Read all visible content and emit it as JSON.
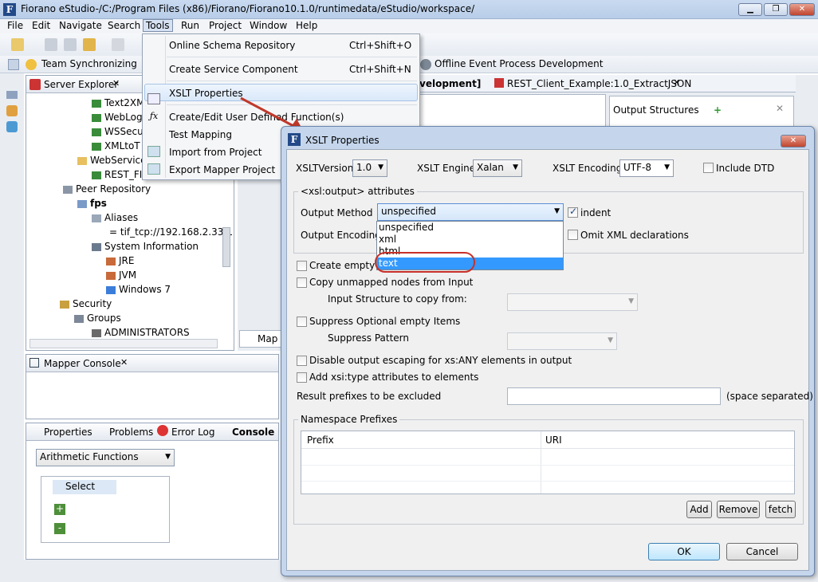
{
  "window": {
    "title": "Fiorano eStudio-/C:/Program Files (x86)/Fiorano/Fiorano10.1.0/runtimedata/eStudio/workspace/",
    "min": "▁",
    "max": "❐",
    "close": "✕"
  },
  "menubar": [
    "File",
    "Edit",
    "Navigate",
    "Search",
    "Tools",
    "Run",
    "Project",
    "Window",
    "Help"
  ],
  "perspectives": {
    "team": "Team Synchronizing",
    "offline": "Offline Event Process Development"
  },
  "server_explorer": {
    "tab": "Server Explorer",
    "items": [
      "Text2XM",
      "WebLog",
      "WSSecu",
      "XMLtoT",
      "WebService",
      "REST_FI",
      "Peer Repository",
      "fps",
      "Aliases",
      "= tif_tcp://192.168.2.33:1",
      "System Information",
      "JRE",
      "JVM",
      "Windows 7",
      "Security",
      "Groups",
      "ADMINISTRATORS"
    ]
  },
  "editor_tabs": {
    "tab1": "velopment]",
    "tab2": "REST_Client_Example:1.0_ExtractJSON",
    "output_structures": "Output Structures",
    "map_tab": "Map"
  },
  "mapper_console": {
    "tab": "Mapper Console"
  },
  "bottom_tabs": [
    "Properties",
    "Problems",
    "Error Log",
    "Console"
  ],
  "functions": {
    "combo": "Arithmetic Functions",
    "items": [
      "Select",
      "+",
      "-"
    ]
  },
  "tools_menu": {
    "items": [
      {
        "label": "Online Schema Repository",
        "shortcut": "Ctrl+Shift+O"
      },
      {
        "label": "Create Service Component",
        "shortcut": "Ctrl+Shift+N"
      },
      {
        "label": "XSLT Properties",
        "shortcut": ""
      },
      {
        "label": "Create/Edit User Defined Function(s)",
        "shortcut": ""
      },
      {
        "label": "Test Mapping",
        "shortcut": ""
      },
      {
        "label": "Import from Project",
        "shortcut": ""
      },
      {
        "label": "Export Mapper Project",
        "shortcut": ""
      }
    ]
  },
  "dialog": {
    "title": "XSLT Properties",
    "xslt_version_label": "XSLTVersion",
    "xslt_version": "1.0",
    "xslt_engine_label": "XSLT Engine",
    "xslt_engine": "Xalan",
    "xslt_encoding_label": "XSLT Encoding",
    "xslt_encoding": "UTF-8",
    "include_dtd": "Include DTD",
    "output_group": "<xsl:output> attributes",
    "output_method_label": "Output Method",
    "output_method": "unspecified",
    "indent": "indent",
    "output_encoding_label": "Output Encoding",
    "omit_xml": "Omit XML declarations",
    "dropdown_options": [
      "unspecified",
      "xml",
      "html",
      "text"
    ],
    "create_empty": "Create empty t",
    "copy_unmapped": "Copy unmapped nodes from Input",
    "input_structure": "Input Structure to copy from:",
    "suppress_optional": "Suppress Optional empty Items",
    "suppress_pattern": "Suppress Pattern",
    "disable_escaping": "Disable output escaping for xs:ANY elements in output",
    "add_xsi": "Add xsi:type attributes to elements",
    "result_prefixes": "Result prefixes to be excluded",
    "space_separated": "(space separated)",
    "ns_group": "Namespace Prefixes",
    "col_prefix": "Prefix",
    "col_uri": "URI",
    "add": "Add",
    "remove": "Remove",
    "fetch": "fetch",
    "ok": "OK",
    "cancel": "Cancel"
  }
}
